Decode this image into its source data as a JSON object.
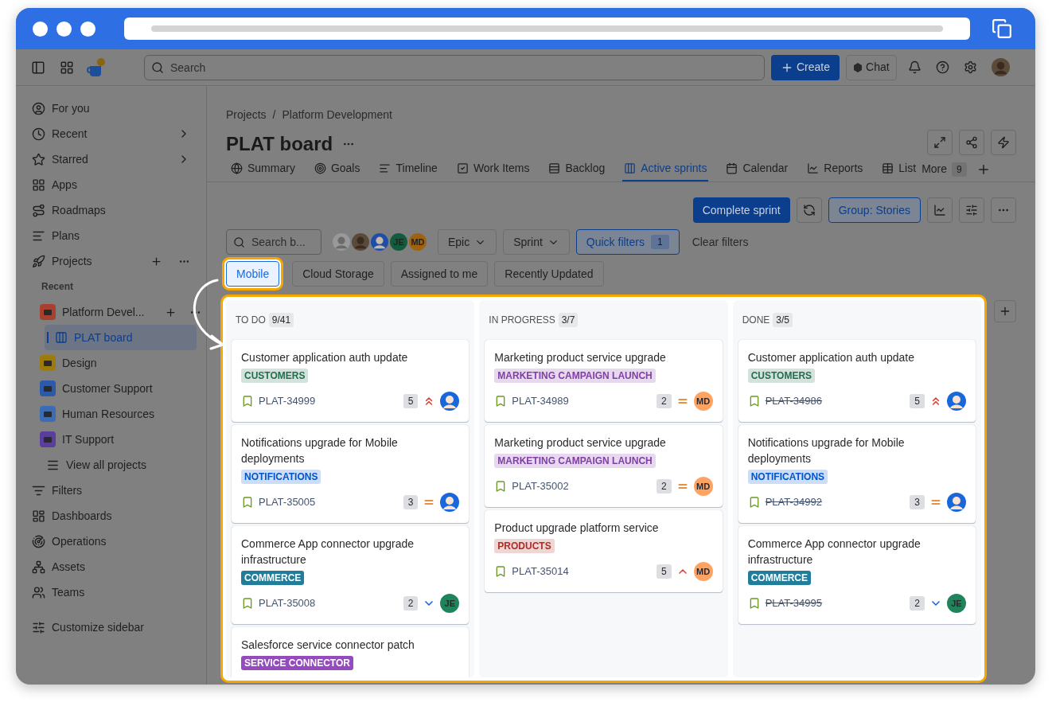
{
  "topbar": {
    "search_placeholder": "Search",
    "create": "Create",
    "chat": "Chat"
  },
  "sidebar": {
    "items": [
      {
        "label": "For you",
        "kind": "plain"
      },
      {
        "label": "Recent",
        "kind": "submenu"
      },
      {
        "label": "Starred",
        "kind": "submenu"
      },
      {
        "label": "Apps",
        "kind": "plain"
      },
      {
        "label": "Roadmaps",
        "kind": "plain"
      },
      {
        "label": "Plans",
        "kind": "plain"
      },
      {
        "label": "Projects",
        "kind": "actions"
      }
    ],
    "recent_heading": "Recent",
    "projects": [
      {
        "label": "Platform Devel...",
        "color": "#a8402e",
        "actions": true,
        "children": [
          {
            "label": "PLAT board",
            "selected": true
          }
        ]
      },
      {
        "label": "Design",
        "color": "#9c7a0c",
        "actions": false
      },
      {
        "label": "Customer Support",
        "color": "#2c5aa8",
        "actions": false
      },
      {
        "label": "Human Resources",
        "color": "#3b6cb4",
        "actions": false
      },
      {
        "label": "IT Support",
        "color": "#5a3e9c",
        "actions": false
      }
    ],
    "view_all": "View all projects",
    "more_items": [
      {
        "label": "Filters"
      },
      {
        "label": "Dashboards"
      },
      {
        "label": "Operations"
      },
      {
        "label": "Assets"
      },
      {
        "label": "Teams"
      }
    ],
    "footer": "Customize sidebar"
  },
  "breadcrumbs": {
    "items": [
      "Projects",
      "Platform Development"
    ],
    "separator": "/"
  },
  "title": "PLAT board",
  "tabs": [
    {
      "label": "Summary",
      "selected": false
    },
    {
      "label": "Goals",
      "selected": false
    },
    {
      "label": "Timeline",
      "selected": false
    },
    {
      "label": "Work Items",
      "selected": false
    },
    {
      "label": "Backlog",
      "selected": false
    },
    {
      "label": "Active sprints",
      "selected": true
    },
    {
      "label": "Calendar",
      "selected": false
    },
    {
      "label": "Reports",
      "selected": false
    },
    {
      "label": "List",
      "selected": false
    }
  ],
  "more_tab": {
    "label": "More",
    "count": "9"
  },
  "actions": {
    "complete": "Complete sprint",
    "group": "Group: Stories"
  },
  "filters": {
    "search_placeholder": "Search b...",
    "avatars": [
      {
        "kind": "generic"
      },
      {
        "kind": "photo"
      },
      {
        "kind": "cartoon"
      },
      {
        "kind": "initials",
        "initials": "JE",
        "color": "#115c3c"
      },
      {
        "kind": "initials",
        "initials": "MD",
        "color": "#a0620e"
      }
    ],
    "dropdowns": [
      "Epic",
      "Sprint"
    ],
    "quick_filters": {
      "label": "Quick filters",
      "count": "1"
    },
    "clear": "Clear filters"
  },
  "chips": [
    {
      "label": "Mobile",
      "selected": true,
      "highlighted": true
    },
    {
      "label": "Cloud Storage",
      "selected": false,
      "highlighted": false
    },
    {
      "label": "Assigned to me",
      "selected": false,
      "highlighted": false
    },
    {
      "label": "Recently Updated",
      "selected": false,
      "highlighted": false
    }
  ],
  "board": {
    "highlighted": true,
    "columns": [
      {
        "name": "TO DO",
        "count": "9/41",
        "cards": [
          {
            "title": "Customer application auth update",
            "tag": {
              "text": "CUSTOMERS",
              "kind": "subtle",
              "color": "#216e4e"
            },
            "key": "PLAT-34999",
            "resolved": false,
            "estimate": "5",
            "priority": {
              "kind": "highest"
            },
            "assignee": {
              "kind": "cartoon"
            }
          },
          {
            "title": "Notifications upgrade for Mobile deployments",
            "tag": {
              "text": "NOTIFICATIONS",
              "kind": "subtle",
              "color": "#0055cc"
            },
            "key": "PLAT-35005",
            "resolved": false,
            "estimate": "3",
            "priority": {
              "kind": "medium"
            },
            "assignee": {
              "kind": "cartoon"
            }
          },
          {
            "title": "Commerce App connector upgrade infrastructure",
            "tag": {
              "text": "COMMERCE",
              "kind": "bold",
              "color": "#227d9b"
            },
            "key": "PLAT-35008",
            "resolved": false,
            "estimate": "2",
            "priority": {
              "kind": "low"
            },
            "assignee": {
              "kind": "initials",
              "initials": "JE",
              "color": "#1f845a"
            }
          },
          {
            "title": "Salesforce service connector patch",
            "tag": {
              "text": "SERVICE CONNECTOR",
              "kind": "bold",
              "color": "#964ac0"
            }
          }
        ]
      },
      {
        "name": "IN PROGRESS",
        "count": "3/7",
        "cards": [
          {
            "title": "Marketing product service upgrade",
            "tag": {
              "text": "MARKETING CAMPAIGN LAUNCH",
              "kind": "subtle",
              "color": "#803fa5"
            },
            "key": "PLAT-34989",
            "resolved": false,
            "estimate": "2",
            "priority": {
              "kind": "medium"
            },
            "assignee": {
              "kind": "initials",
              "initials": "MD",
              "color": "#fea362"
            }
          },
          {
            "title": "Marketing product service upgrade",
            "tag": {
              "text": "MARKETING CAMPAIGN LAUNCH",
              "kind": "subtle",
              "color": "#803fa5"
            },
            "key": "PLAT-35002",
            "resolved": false,
            "estimate": "2",
            "priority": {
              "kind": "medium"
            },
            "assignee": {
              "kind": "initials",
              "initials": "MD",
              "color": "#fea362"
            }
          },
          {
            "title": "Product upgrade platform service",
            "tag": {
              "text": "PRODUCTS",
              "kind": "subtle",
              "color": "#ae2e24"
            },
            "key": "PLAT-35014",
            "resolved": false,
            "estimate": "5",
            "priority": {
              "kind": "high"
            },
            "assignee": {
              "kind": "initials",
              "initials": "MD",
              "color": "#fea362"
            }
          }
        ]
      },
      {
        "name": "DONE",
        "count": "3/5",
        "cards": [
          {
            "title": "Customer application auth update",
            "tag": {
              "text": "CUSTOMERS",
              "kind": "subtle",
              "color": "#216e4e"
            },
            "key": "PLAT-34986",
            "resolved": true,
            "estimate": "5",
            "priority": {
              "kind": "highest"
            },
            "assignee": {
              "kind": "cartoon"
            }
          },
          {
            "title": "Notifications upgrade for Mobile deployments",
            "tag": {
              "text": "NOTIFICATIONS",
              "kind": "subtle",
              "color": "#0055cc"
            },
            "key": "PLAT-34992",
            "resolved": true,
            "estimate": "3",
            "priority": {
              "kind": "medium"
            },
            "assignee": {
              "kind": "cartoon"
            }
          },
          {
            "title": "Commerce App connector upgrade infrastructure",
            "tag": {
              "text": "COMMERCE",
              "kind": "bold",
              "color": "#227d9b"
            },
            "key": "PLAT-34995",
            "resolved": true,
            "estimate": "2",
            "priority": {
              "kind": "low"
            },
            "assignee": {
              "kind": "initials",
              "initials": "JE",
              "color": "#1f845a"
            }
          }
        ]
      }
    ]
  }
}
